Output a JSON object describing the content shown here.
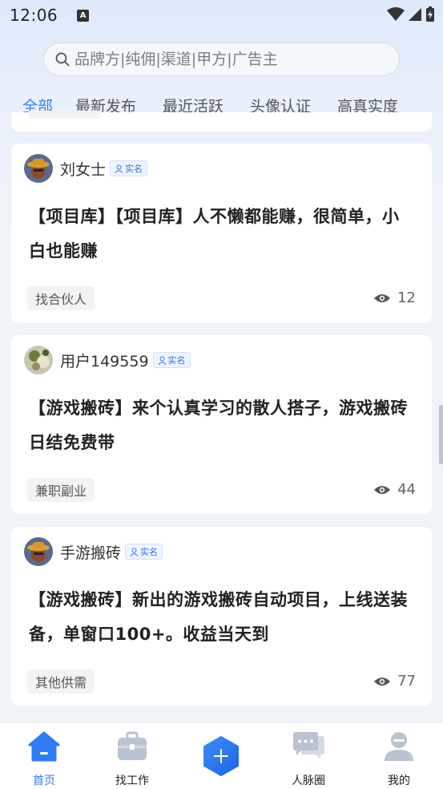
{
  "status_bar": {
    "time": "12:06",
    "notification_icon": "A"
  },
  "search": {
    "placeholder": "品牌方|纯佣|渠道|甲方|广告主"
  },
  "tabs": [
    {
      "label": "全部",
      "active": true
    },
    {
      "label": "最新发布"
    },
    {
      "label": "最近活跃"
    },
    {
      "label": "头像认证"
    },
    {
      "label": "高真实度"
    }
  ],
  "posts": [
    {
      "user": "刘女士",
      "badge": "实名",
      "title": "【项目库】【项目库】人不懒都能赚，很简单，小白也能赚",
      "tag": "找合伙人",
      "views": "12"
    },
    {
      "user": "用户149559",
      "badge": "实名",
      "title": "【游戏搬砖】来个认真学习的散人搭子，游戏搬砖日结免费带",
      "tag": "兼职副业",
      "views": "44"
    },
    {
      "user": "手游搬砖",
      "badge": "实名",
      "title": "【游戏搬砖】新出的游戏搬砖自动项目，上线送装备，单窗口100+。收益当天到",
      "tag": "其他供需",
      "views": "77"
    }
  ],
  "nav": [
    {
      "label": "首页",
      "icon": "home-icon",
      "active": true
    },
    {
      "label": "找工作",
      "icon": "briefcase-icon"
    },
    {
      "label": "",
      "icon": "plus-icon"
    },
    {
      "label": "人脉圈",
      "icon": "chat-icon"
    },
    {
      "label": "我的",
      "icon": "user-icon"
    }
  ],
  "colors": {
    "accent": "#2f7cf6",
    "background": "#f0f3f8",
    "card": "#ffffff"
  }
}
